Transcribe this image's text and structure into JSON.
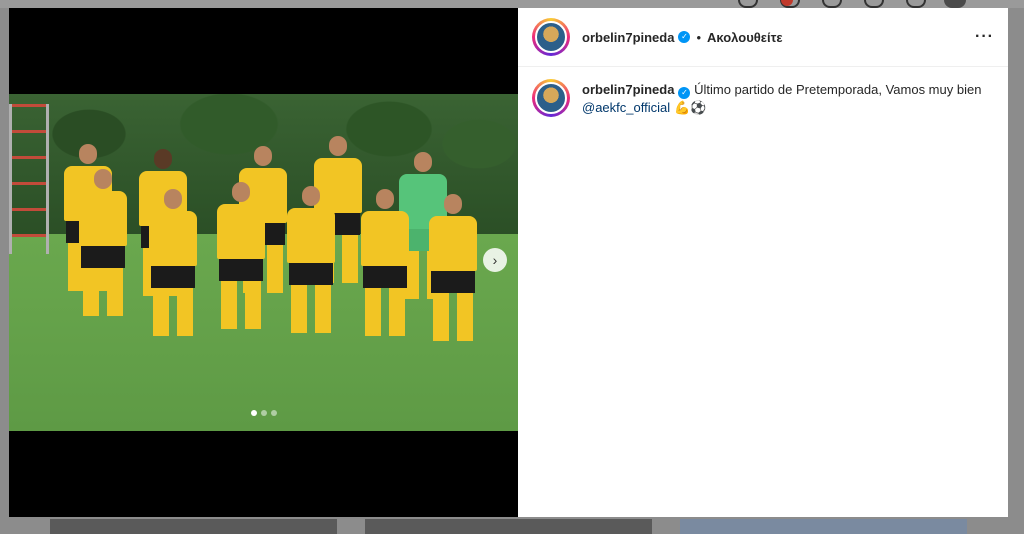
{
  "post": {
    "username": "orbelin7pineda",
    "follow_state": "Ακολουθείτε",
    "more_icon": "more-horizontal-icon",
    "caption": {
      "username": "orbelin7pineda",
      "text": "Último partido de Pretemporada, Vamos muy bien",
      "mention": "@aekfc_official",
      "emojis": "💪⚽"
    },
    "carousel": {
      "current": 1,
      "total": 3
    },
    "next_icon": "chevron-right-icon",
    "verified_icon": "verified-badge-icon",
    "bullet": "•"
  },
  "colors": {
    "verified": "#0095f6",
    "mention": "#00376b",
    "jersey": "#f2c524"
  }
}
